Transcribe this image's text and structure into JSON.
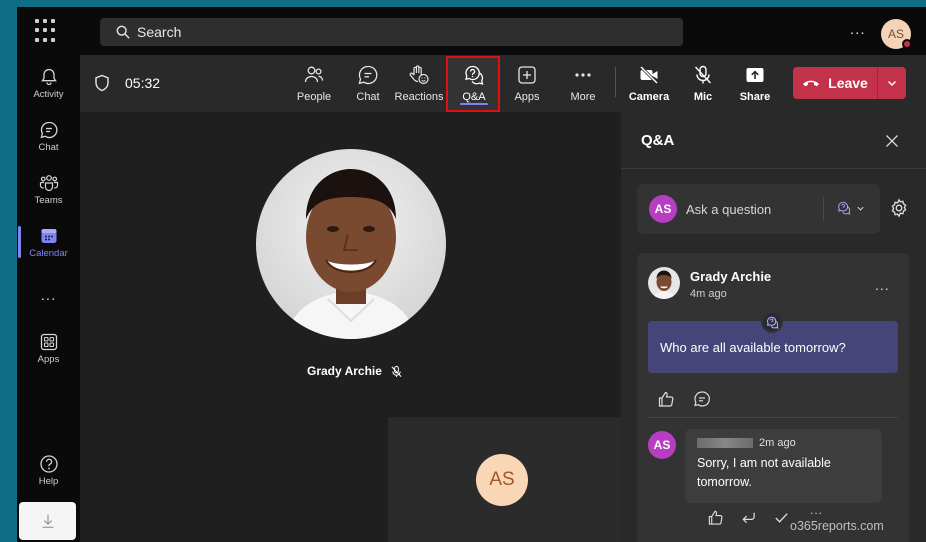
{
  "topbar": {
    "search_placeholder": "Search",
    "more": "...",
    "avatar_initials": "AS"
  },
  "rail": {
    "items": [
      {
        "label": "Activity",
        "icon": "bell-icon"
      },
      {
        "label": "Chat",
        "icon": "chat-icon"
      },
      {
        "label": "Teams",
        "icon": "teams-icon"
      },
      {
        "label": "Calendar",
        "icon": "calendar-icon",
        "active": true
      },
      {
        "label": "Apps",
        "icon": "apps-icon"
      },
      {
        "label": "Help",
        "icon": "help-icon"
      }
    ],
    "more": "..."
  },
  "meeting": {
    "timer": "05:32",
    "toolbar": {
      "people": "People",
      "chat": "Chat",
      "reactions": "Reactions",
      "qa": "Q&A",
      "apps": "Apps",
      "more": "More",
      "camera": "Camera",
      "mic": "Mic",
      "share": "Share",
      "leave": "Leave"
    },
    "participant_name": "Grady Archie",
    "tile_initials": "AS"
  },
  "qa_panel": {
    "title": "Q&A",
    "ask_placeholder": "Ask a question",
    "ask_avatar": "AS",
    "question": {
      "author": "Grady Archie",
      "time": "4m ago",
      "text": "Who are all available tomorrow?"
    },
    "reply": {
      "avatar": "AS",
      "time": "2m ago",
      "text": "Sorry, I am not available tomorrow."
    },
    "more": "...",
    "reply_more": "..."
  },
  "watermark": "o365reports.com",
  "colors": {
    "accent": "#7f85f5",
    "leave": "#c4314b",
    "avatar_purple": "#b73ec1",
    "question_bg": "#46457a",
    "highlight_border": "#dd1111"
  }
}
